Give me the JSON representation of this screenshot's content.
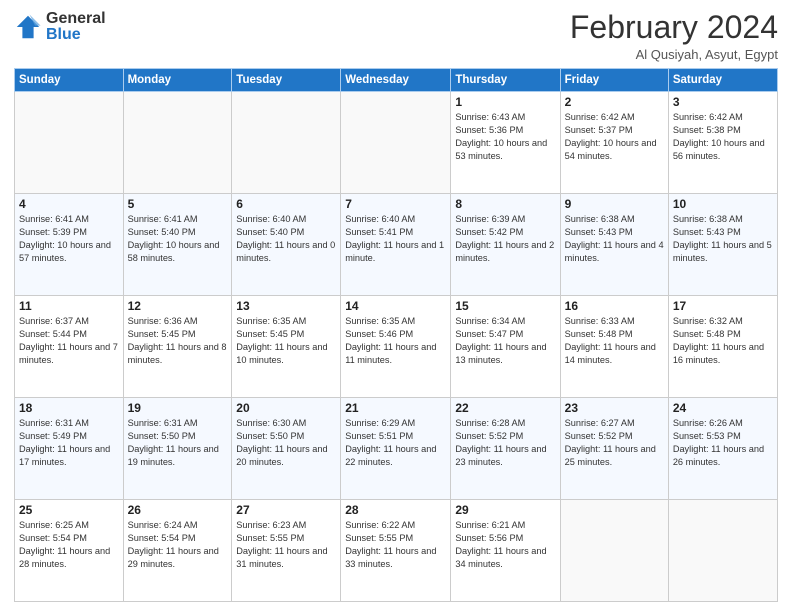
{
  "logo": {
    "line1": "General",
    "line2": "Blue"
  },
  "header": {
    "month": "February 2024",
    "location": "Al Qusiyah, Asyut, Egypt"
  },
  "days_of_week": [
    "Sunday",
    "Monday",
    "Tuesday",
    "Wednesday",
    "Thursday",
    "Friday",
    "Saturday"
  ],
  "weeks": [
    [
      {
        "day": "",
        "info": ""
      },
      {
        "day": "",
        "info": ""
      },
      {
        "day": "",
        "info": ""
      },
      {
        "day": "",
        "info": ""
      },
      {
        "day": "1",
        "info": "Sunrise: 6:43 AM\nSunset: 5:36 PM\nDaylight: 10 hours\nand 53 minutes."
      },
      {
        "day": "2",
        "info": "Sunrise: 6:42 AM\nSunset: 5:37 PM\nDaylight: 10 hours\nand 54 minutes."
      },
      {
        "day": "3",
        "info": "Sunrise: 6:42 AM\nSunset: 5:38 PM\nDaylight: 10 hours\nand 56 minutes."
      }
    ],
    [
      {
        "day": "4",
        "info": "Sunrise: 6:41 AM\nSunset: 5:39 PM\nDaylight: 10 hours\nand 57 minutes."
      },
      {
        "day": "5",
        "info": "Sunrise: 6:41 AM\nSunset: 5:40 PM\nDaylight: 10 hours\nand 58 minutes."
      },
      {
        "day": "6",
        "info": "Sunrise: 6:40 AM\nSunset: 5:40 PM\nDaylight: 11 hours\nand 0 minutes."
      },
      {
        "day": "7",
        "info": "Sunrise: 6:40 AM\nSunset: 5:41 PM\nDaylight: 11 hours\nand 1 minute."
      },
      {
        "day": "8",
        "info": "Sunrise: 6:39 AM\nSunset: 5:42 PM\nDaylight: 11 hours\nand 2 minutes."
      },
      {
        "day": "9",
        "info": "Sunrise: 6:38 AM\nSunset: 5:43 PM\nDaylight: 11 hours\nand 4 minutes."
      },
      {
        "day": "10",
        "info": "Sunrise: 6:38 AM\nSunset: 5:43 PM\nDaylight: 11 hours\nand 5 minutes."
      }
    ],
    [
      {
        "day": "11",
        "info": "Sunrise: 6:37 AM\nSunset: 5:44 PM\nDaylight: 11 hours\nand 7 minutes."
      },
      {
        "day": "12",
        "info": "Sunrise: 6:36 AM\nSunset: 5:45 PM\nDaylight: 11 hours\nand 8 minutes."
      },
      {
        "day": "13",
        "info": "Sunrise: 6:35 AM\nSunset: 5:45 PM\nDaylight: 11 hours\nand 10 minutes."
      },
      {
        "day": "14",
        "info": "Sunrise: 6:35 AM\nSunset: 5:46 PM\nDaylight: 11 hours\nand 11 minutes."
      },
      {
        "day": "15",
        "info": "Sunrise: 6:34 AM\nSunset: 5:47 PM\nDaylight: 11 hours\nand 13 minutes."
      },
      {
        "day": "16",
        "info": "Sunrise: 6:33 AM\nSunset: 5:48 PM\nDaylight: 11 hours\nand 14 minutes."
      },
      {
        "day": "17",
        "info": "Sunrise: 6:32 AM\nSunset: 5:48 PM\nDaylight: 11 hours\nand 16 minutes."
      }
    ],
    [
      {
        "day": "18",
        "info": "Sunrise: 6:31 AM\nSunset: 5:49 PM\nDaylight: 11 hours\nand 17 minutes."
      },
      {
        "day": "19",
        "info": "Sunrise: 6:31 AM\nSunset: 5:50 PM\nDaylight: 11 hours\nand 19 minutes."
      },
      {
        "day": "20",
        "info": "Sunrise: 6:30 AM\nSunset: 5:50 PM\nDaylight: 11 hours\nand 20 minutes."
      },
      {
        "day": "21",
        "info": "Sunrise: 6:29 AM\nSunset: 5:51 PM\nDaylight: 11 hours\nand 22 minutes."
      },
      {
        "day": "22",
        "info": "Sunrise: 6:28 AM\nSunset: 5:52 PM\nDaylight: 11 hours\nand 23 minutes."
      },
      {
        "day": "23",
        "info": "Sunrise: 6:27 AM\nSunset: 5:52 PM\nDaylight: 11 hours\nand 25 minutes."
      },
      {
        "day": "24",
        "info": "Sunrise: 6:26 AM\nSunset: 5:53 PM\nDaylight: 11 hours\nand 26 minutes."
      }
    ],
    [
      {
        "day": "25",
        "info": "Sunrise: 6:25 AM\nSunset: 5:54 PM\nDaylight: 11 hours\nand 28 minutes."
      },
      {
        "day": "26",
        "info": "Sunrise: 6:24 AM\nSunset: 5:54 PM\nDaylight: 11 hours\nand 29 minutes."
      },
      {
        "day": "27",
        "info": "Sunrise: 6:23 AM\nSunset: 5:55 PM\nDaylight: 11 hours\nand 31 minutes."
      },
      {
        "day": "28",
        "info": "Sunrise: 6:22 AM\nSunset: 5:55 PM\nDaylight: 11 hours\nand 33 minutes."
      },
      {
        "day": "29",
        "info": "Sunrise: 6:21 AM\nSunset: 5:56 PM\nDaylight: 11 hours\nand 34 minutes."
      },
      {
        "day": "",
        "info": ""
      },
      {
        "day": "",
        "info": ""
      }
    ]
  ]
}
